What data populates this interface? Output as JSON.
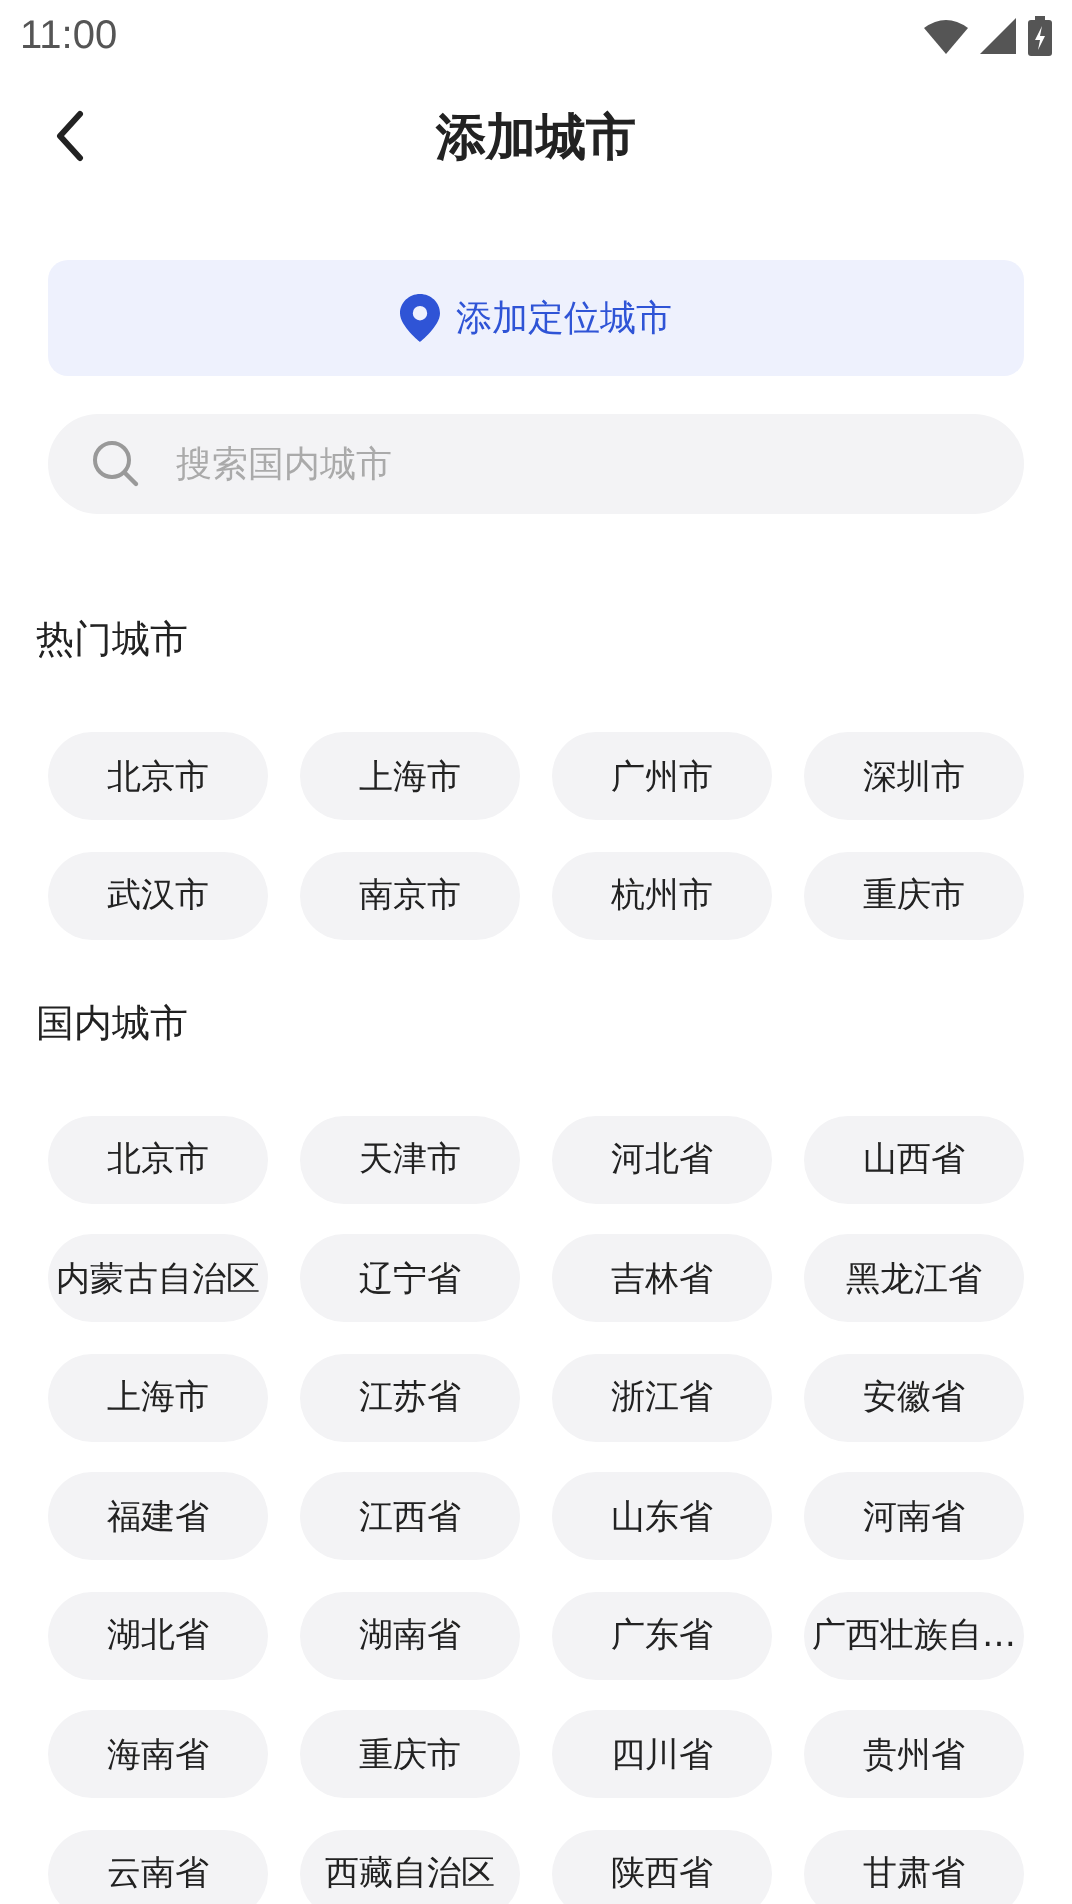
{
  "status_bar": {
    "time": "11:00"
  },
  "header": {
    "title": "添加城市"
  },
  "location_button": {
    "label": "添加定位城市"
  },
  "search": {
    "placeholder": "搜索国内城市"
  },
  "sections": [
    {
      "title": "热门城市",
      "cities": [
        "北京市",
        "上海市",
        "广州市",
        "深圳市",
        "武汉市",
        "南京市",
        "杭州市",
        "重庆市"
      ]
    },
    {
      "title": "国内城市",
      "cities": [
        "北京市",
        "天津市",
        "河北省",
        "山西省",
        "内蒙古自治区",
        "辽宁省",
        "吉林省",
        "黑龙江省",
        "上海市",
        "江苏省",
        "浙江省",
        "安徽省",
        "福建省",
        "江西省",
        "山东省",
        "河南省",
        "湖北省",
        "湖南省",
        "广东省",
        "广西壮族自…",
        "海南省",
        "重庆市",
        "四川省",
        "贵州省",
        "云南省",
        "西藏自治区",
        "陕西省",
        "甘肃省"
      ]
    }
  ]
}
